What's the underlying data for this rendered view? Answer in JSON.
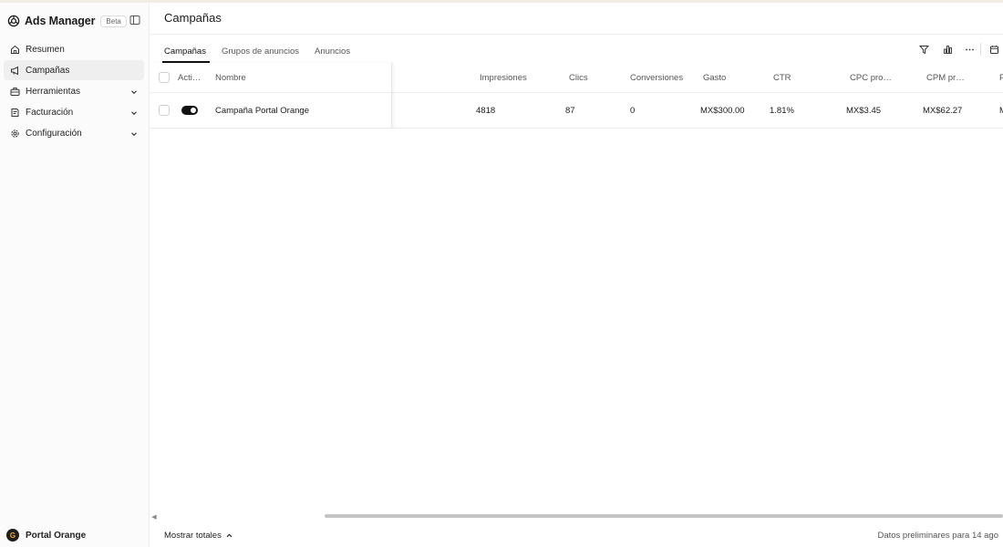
{
  "app": {
    "title": "Ads Manager",
    "badge": "Beta"
  },
  "sidebar": {
    "items": [
      {
        "label": "Resumen",
        "icon": "home-icon"
      },
      {
        "label": "Campañas",
        "icon": "megaphone-icon",
        "active": true
      },
      {
        "label": "Herramientas",
        "icon": "briefcase-icon",
        "expandable": true
      },
      {
        "label": "Facturación",
        "icon": "receipt-icon",
        "expandable": true
      },
      {
        "label": "Configuración",
        "icon": "gear-icon",
        "expandable": true
      }
    ],
    "account": {
      "name": "Portal Orange",
      "avatar_letter": "G"
    }
  },
  "page": {
    "title": "Campañas"
  },
  "tabs": [
    {
      "label": "Campañas",
      "active": true
    },
    {
      "label": "Grupos de anuncios"
    },
    {
      "label": "Anuncios"
    }
  ],
  "toolbar": {
    "icons": [
      "filter-icon",
      "bar-chart-icon",
      "more-icon",
      "calendar-icon"
    ]
  },
  "table": {
    "headers": {
      "active": "Acti…",
      "name": "Nombre",
      "impressions": "Impresiones",
      "clicks": "Clics",
      "conversions": "Conversiones",
      "spend": "Gasto",
      "ctr": "CTR",
      "cpc": "CPC pro…",
      "cpm": "CPM pr…",
      "more": "P"
    },
    "rows": [
      {
        "active": true,
        "name": "Campaña Portal Orange",
        "impressions": "4818",
        "clicks": "87",
        "conversions": "0",
        "spend": "MX$300.00",
        "ctr": "1.81%",
        "cpc": "MX$3.45",
        "cpm": "MX$62.27",
        "more": "M"
      }
    ]
  },
  "footer": {
    "show_totals": "Mostrar totales",
    "preliminary": "Datos preliminares para 14 ago"
  },
  "colors": {
    "accent": "#111111",
    "border": "#ececec",
    "sidebar_bg": "#fbfbfb",
    "active_nav_bg": "#efefef",
    "avatar_letter": "#f5a623"
  }
}
